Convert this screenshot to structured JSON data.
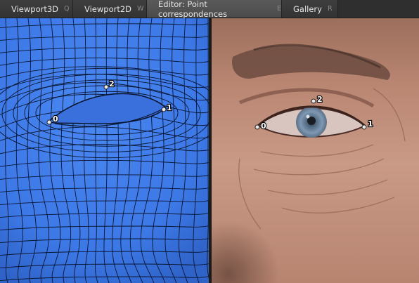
{
  "tabs": [
    {
      "label": "Viewport3D",
      "shortcut": "Q"
    },
    {
      "label": "Viewport2D",
      "shortcut": "W"
    },
    {
      "label": "Editor: Point correspondences",
      "shortcut": "E"
    },
    {
      "label": "Gallery",
      "shortcut": "R"
    }
  ],
  "active_tab": "Editor: Point correspondences",
  "left_viewport": {
    "markers": [
      {
        "id": "0",
        "label": "0"
      },
      {
        "id": "1",
        "label": "1"
      },
      {
        "id": "2",
        "label": "2"
      }
    ]
  },
  "right_viewport": {
    "markers": [
      {
        "id": "0",
        "label": "0"
      },
      {
        "id": "1",
        "label": "1"
      },
      {
        "id": "2",
        "label": "2"
      }
    ]
  },
  "colors": {
    "mesh_fill": "#3c78e6",
    "mesh_line": "#0a1530",
    "skin": "#c99a86",
    "marker": "#e8e8e8"
  }
}
